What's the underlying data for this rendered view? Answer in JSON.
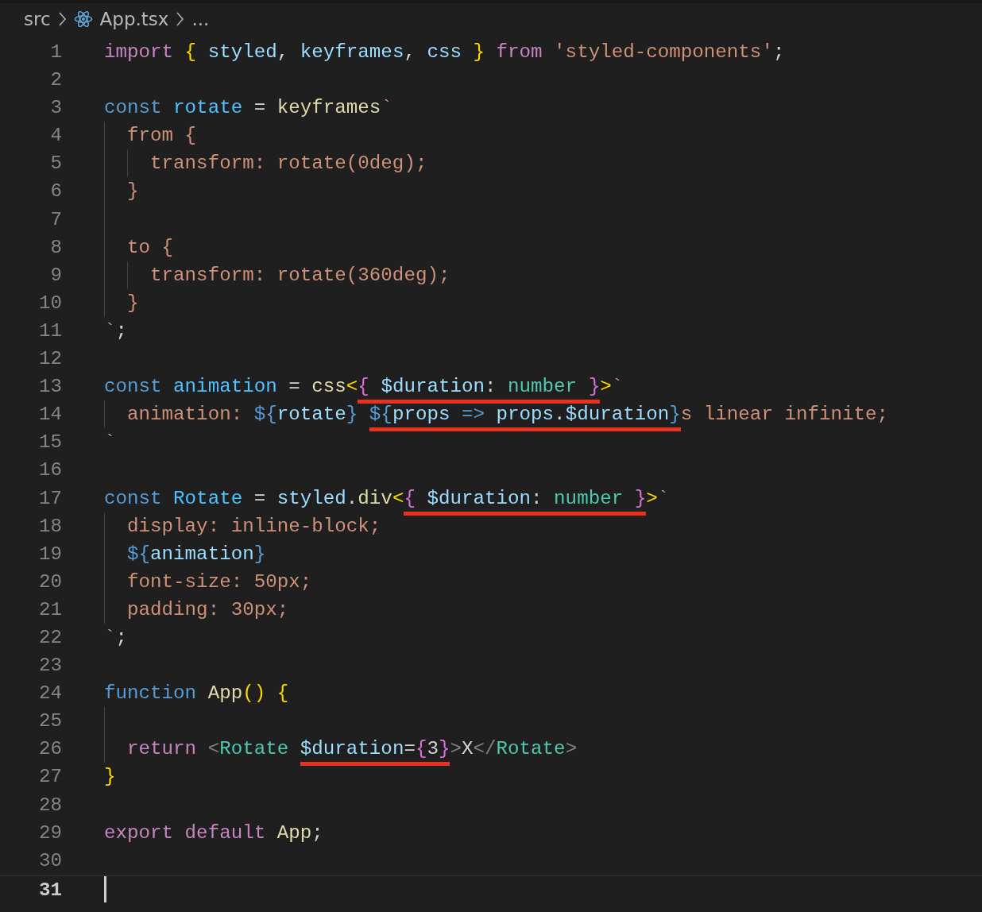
{
  "breadcrumbs": [
    {
      "kind": "folder",
      "text": "src"
    },
    {
      "kind": "react-file",
      "text": "App.tsx"
    },
    {
      "kind": "more",
      "text": "..."
    }
  ],
  "lines": [
    {
      "number": "1",
      "current": false,
      "tokens": [
        {
          "kind": "keyword",
          "text": "import "
        },
        {
          "kind": "brace1",
          "text": "{ "
        },
        {
          "kind": "variable",
          "text": "styled"
        },
        {
          "kind": "plain",
          "text": ", "
        },
        {
          "kind": "variable",
          "text": "keyframes"
        },
        {
          "kind": "plain",
          "text": ", "
        },
        {
          "kind": "variable",
          "text": "css "
        },
        {
          "kind": "brace1",
          "text": "} "
        },
        {
          "kind": "keyword",
          "text": "from "
        },
        {
          "kind": "string",
          "text": "'styled-components'"
        },
        {
          "kind": "plain",
          "text": ";"
        }
      ]
    },
    {
      "number": "2",
      "current": false
    },
    {
      "number": "3",
      "current": false,
      "tokens": [
        {
          "kind": "storage",
          "text": "const "
        },
        {
          "kind": "constant",
          "text": "rotate"
        },
        {
          "kind": "plain",
          "text": " = "
        },
        {
          "kind": "function",
          "text": "keyframes"
        },
        {
          "kind": "string",
          "text": "`"
        }
      ]
    },
    {
      "number": "4",
      "current": false,
      "tokens": [
        {
          "kind": "string",
          "text": "  from {"
        }
      ]
    },
    {
      "number": "5",
      "current": false,
      "tokens": [
        {
          "kind": "string",
          "text": "    transform: rotate(0deg);"
        }
      ]
    },
    {
      "number": "6",
      "current": false,
      "tokens": [
        {
          "kind": "string",
          "text": "  }"
        }
      ]
    },
    {
      "number": "7",
      "current": false
    },
    {
      "number": "8",
      "current": false,
      "tokens": [
        {
          "kind": "string",
          "text": "  to {"
        }
      ]
    },
    {
      "number": "9",
      "current": false,
      "tokens": [
        {
          "kind": "string",
          "text": "    transform: rotate(360deg);"
        }
      ]
    },
    {
      "number": "10",
      "current": false,
      "tokens": [
        {
          "kind": "string",
          "text": "  }"
        }
      ]
    },
    {
      "number": "11",
      "current": false,
      "tokens": [
        {
          "kind": "string",
          "text": "`"
        },
        {
          "kind": "plain",
          "text": ";"
        }
      ]
    },
    {
      "number": "12",
      "current": false
    },
    {
      "number": "13",
      "current": false,
      "tokens": [
        {
          "kind": "storage",
          "text": "const "
        },
        {
          "kind": "constant",
          "text": "animation"
        },
        {
          "kind": "plain",
          "text": " = "
        },
        {
          "kind": "function",
          "text": "css"
        },
        {
          "kind": "brace1",
          "text": "<"
        },
        {
          "kind": "underlined",
          "tokens": [
            {
              "kind": "brace2",
              "text": "{ "
            },
            {
              "kind": "variable",
              "text": "$duration"
            },
            {
              "kind": "plain",
              "text": ": "
            },
            {
              "kind": "type",
              "text": "number "
            },
            {
              "kind": "brace2",
              "text": "}"
            }
          ]
        },
        {
          "kind": "brace1",
          "text": ">"
        },
        {
          "kind": "string",
          "text": "`"
        }
      ]
    },
    {
      "number": "14",
      "current": false,
      "tokens": [
        {
          "kind": "string",
          "text": "  animation: "
        },
        {
          "kind": "brace3",
          "text": "${"
        },
        {
          "kind": "variable",
          "text": "rotate"
        },
        {
          "kind": "brace3",
          "text": "} "
        },
        {
          "kind": "underlined",
          "tokens": [
            {
              "kind": "brace3",
              "text": "${"
            },
            {
              "kind": "variable",
              "text": "props "
            },
            {
              "kind": "storage",
              "text": "=> "
            },
            {
              "kind": "variable",
              "text": "props"
            },
            {
              "kind": "plain",
              "text": "."
            },
            {
              "kind": "variable",
              "text": "$duration"
            },
            {
              "kind": "brace3",
              "text": "}"
            }
          ]
        },
        {
          "kind": "string",
          "text": "s linear infinite;"
        }
      ]
    },
    {
      "number": "15",
      "current": false,
      "tokens": [
        {
          "kind": "string",
          "text": "`"
        }
      ]
    },
    {
      "number": "16",
      "current": false
    },
    {
      "number": "17",
      "current": false,
      "tokens": [
        {
          "kind": "storage",
          "text": "const "
        },
        {
          "kind": "constant",
          "text": "Rotate"
        },
        {
          "kind": "plain",
          "text": " = "
        },
        {
          "kind": "variable",
          "text": "styled"
        },
        {
          "kind": "plain",
          "text": "."
        },
        {
          "kind": "function",
          "text": "div"
        },
        {
          "kind": "brace1",
          "text": "<"
        },
        {
          "kind": "underlined",
          "tokens": [
            {
              "kind": "brace2",
              "text": "{ "
            },
            {
              "kind": "variable",
              "text": "$duration"
            },
            {
              "kind": "plain",
              "text": ": "
            },
            {
              "kind": "type",
              "text": "number "
            },
            {
              "kind": "brace2",
              "text": "}"
            }
          ]
        },
        {
          "kind": "brace1",
          "text": ">"
        },
        {
          "kind": "string",
          "text": "`"
        }
      ]
    },
    {
      "number": "18",
      "current": false,
      "tokens": [
        {
          "kind": "string",
          "text": "  display: inline-block;"
        }
      ]
    },
    {
      "number": "19",
      "current": false,
      "tokens": [
        {
          "kind": "brace3",
          "text": "  ${"
        },
        {
          "kind": "variable",
          "text": "animation"
        },
        {
          "kind": "brace3",
          "text": "}"
        }
      ]
    },
    {
      "number": "20",
      "current": false,
      "tokens": [
        {
          "kind": "string",
          "text": "  font-size: 50px;"
        }
      ]
    },
    {
      "number": "21",
      "current": false,
      "tokens": [
        {
          "kind": "string",
          "text": "  padding: 30px;"
        }
      ]
    },
    {
      "number": "22",
      "current": false,
      "tokens": [
        {
          "kind": "string",
          "text": "`"
        },
        {
          "kind": "plain",
          "text": ";"
        }
      ]
    },
    {
      "number": "23",
      "current": false
    },
    {
      "number": "24",
      "current": false,
      "tokens": [
        {
          "kind": "storage",
          "text": "function "
        },
        {
          "kind": "function",
          "text": "App"
        },
        {
          "kind": "brace1",
          "text": "() {"
        }
      ]
    },
    {
      "number": "25",
      "current": false
    },
    {
      "number": "26",
      "current": false,
      "tokens": [
        {
          "kind": "keyword",
          "text": "  return "
        },
        {
          "kind": "tag",
          "text": "<"
        },
        {
          "kind": "type",
          "text": "Rotate "
        },
        {
          "kind": "underlined",
          "tokens": [
            {
              "kind": "variable",
              "text": "$duration"
            },
            {
              "kind": "plain",
              "text": "="
            },
            {
              "kind": "brace2",
              "text": "{"
            },
            {
              "kind": "plain",
              "text": "3"
            },
            {
              "kind": "brace2",
              "text": "}"
            }
          ]
        },
        {
          "kind": "tag",
          "text": ">"
        },
        {
          "kind": "plain",
          "text": "X"
        },
        {
          "kind": "tag",
          "text": "</"
        },
        {
          "kind": "type",
          "text": "Rotate"
        },
        {
          "kind": "tag",
          "text": ">"
        }
      ]
    },
    {
      "number": "27",
      "current": false,
      "tokens": [
        {
          "kind": "brace1",
          "text": "}"
        }
      ]
    },
    {
      "number": "28",
      "current": false
    },
    {
      "number": "29",
      "current": false,
      "tokens": [
        {
          "kind": "keyword",
          "text": "export default "
        },
        {
          "kind": "function",
          "text": "App"
        },
        {
          "kind": "plain",
          "text": ";"
        }
      ]
    },
    {
      "number": "30",
      "current": false
    },
    {
      "number": "31",
      "current": true
    }
  ]
}
